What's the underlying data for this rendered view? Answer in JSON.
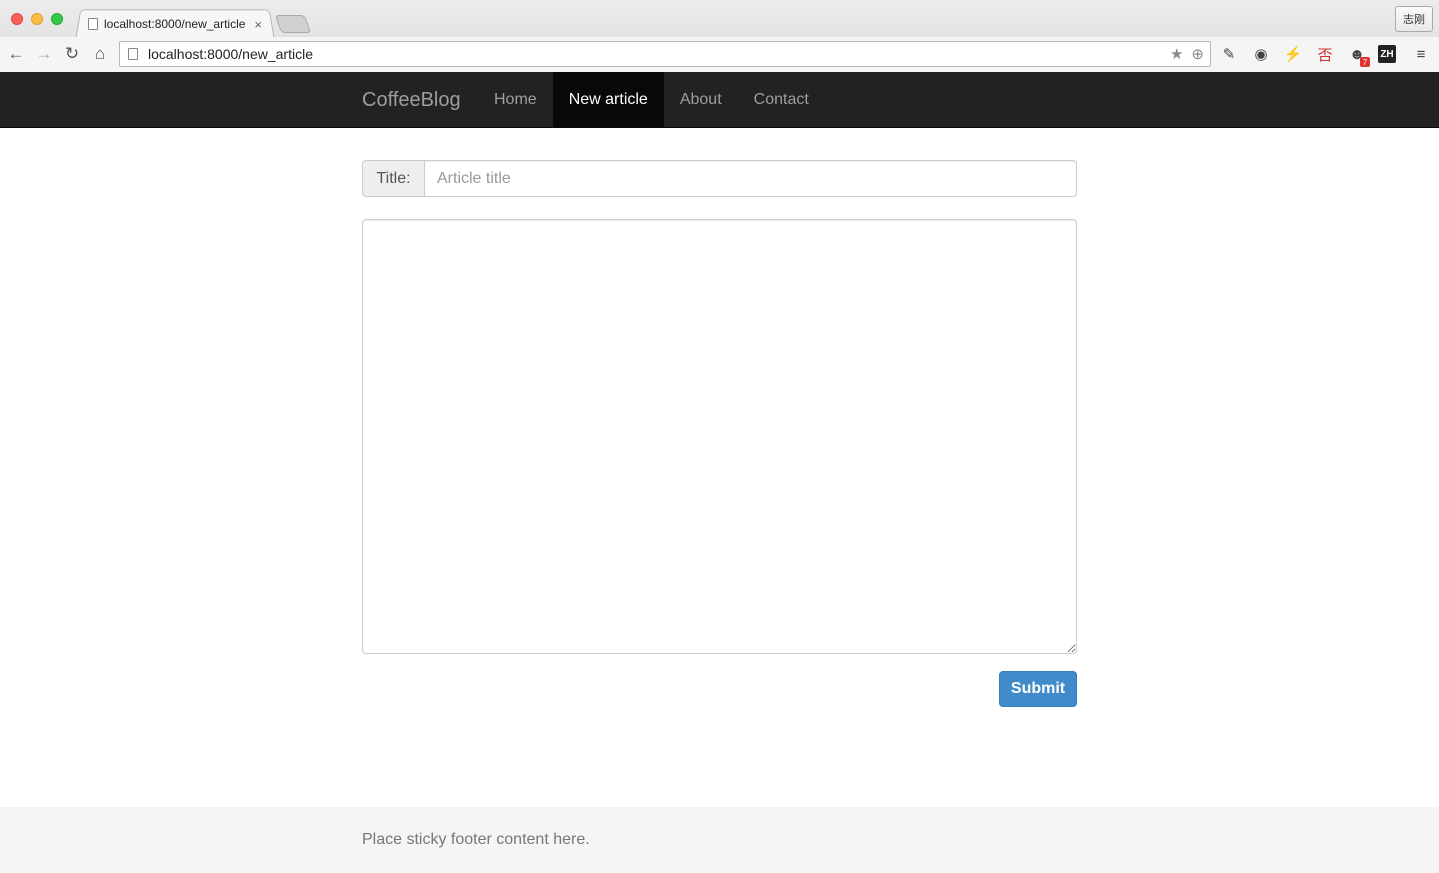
{
  "browser": {
    "tab_title": "localhost:8000/new_article",
    "tab_close": "×",
    "profile_label": "志刚",
    "url": "localhost:8000/new_article",
    "back_icon": "arrow-left-icon",
    "forward_icon": "arrow-right-icon",
    "reload_icon": "reload-icon",
    "home_icon": "home-icon",
    "extensions": [
      {
        "name": "pin-icon",
        "glyph": "✎"
      },
      {
        "name": "pocket-icon",
        "glyph": "◉"
      },
      {
        "name": "lightning-icon",
        "glyph": "⚡"
      },
      {
        "name": "translate-icon",
        "glyph": "否"
      },
      {
        "name": "ghost-icon",
        "glyph": "☻",
        "badge": "7"
      },
      {
        "name": "zh-icon",
        "glyph": "ZH"
      }
    ]
  },
  "navbar": {
    "brand": "CoffeeBlog",
    "links": [
      {
        "label": "Home",
        "active": false
      },
      {
        "label": "New article",
        "active": true
      },
      {
        "label": "About",
        "active": false
      },
      {
        "label": "Contact",
        "active": false
      }
    ]
  },
  "form": {
    "title_label": "Title:",
    "title_placeholder": "Article title",
    "title_value": "",
    "body_value": "",
    "submit_label": "Submit"
  },
  "footer": {
    "text": "Place sticky footer content here."
  },
  "colors": {
    "navbar_bg": "#222222",
    "active_link_bg": "#080808",
    "primary": "#428bca"
  }
}
